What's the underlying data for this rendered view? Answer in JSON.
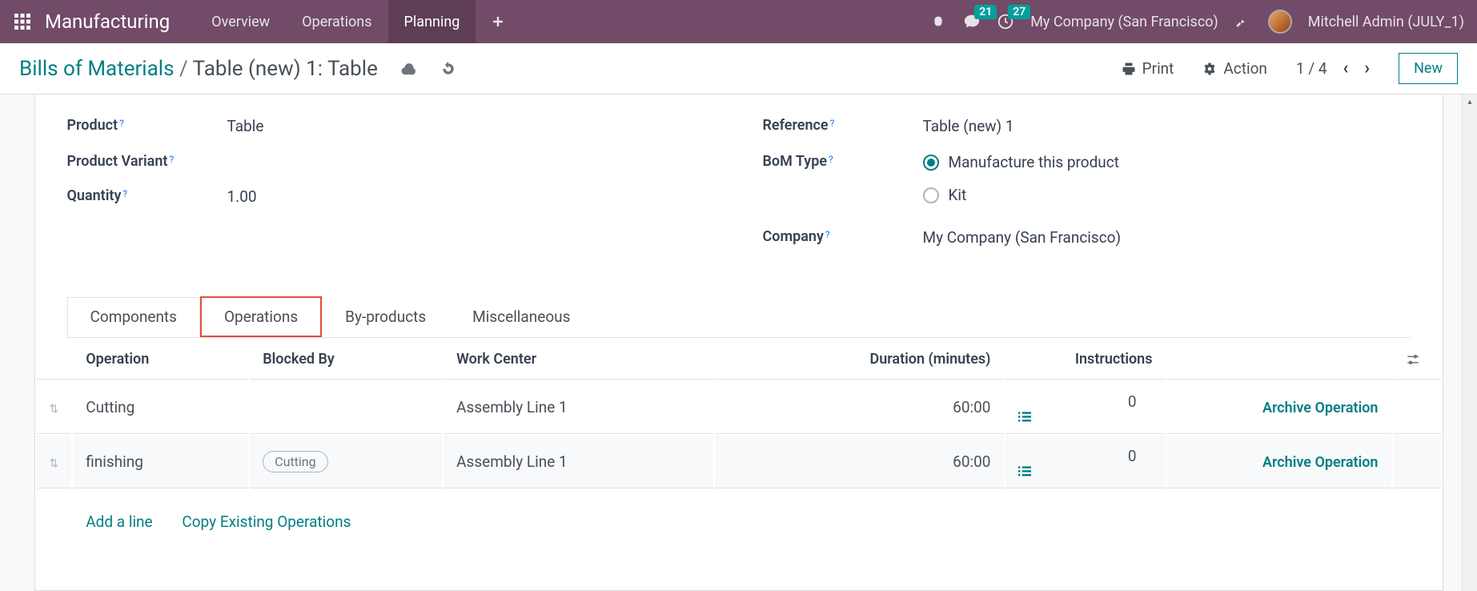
{
  "navbar": {
    "app_name": "Manufacturing",
    "items": [
      {
        "label": "Overview",
        "active": false
      },
      {
        "label": "Operations",
        "active": false
      },
      {
        "label": "Planning",
        "active": true
      }
    ],
    "messages_badge": "21",
    "activities_badge": "27",
    "company": "My Company (San Francisco)",
    "user": "Mitchell Admin (JULY_1)"
  },
  "controlbar": {
    "breadcrumb_root": "Bills of Materials",
    "breadcrumb_current": "Table (new) 1: Table",
    "print_label": "Print",
    "action_label": "Action",
    "pager": "1 / 4",
    "new_label": "New"
  },
  "form": {
    "left": {
      "product_label": "Product",
      "product_value": "Table",
      "variant_label": "Product Variant",
      "quantity_label": "Quantity",
      "quantity_value": "1.00"
    },
    "right": {
      "reference_label": "Reference",
      "reference_value": "Table (new) 1",
      "bom_type_label": "BoM Type",
      "bom_type_options": [
        {
          "label": "Manufacture this product",
          "checked": true
        },
        {
          "label": "Kit",
          "checked": false
        }
      ],
      "company_label": "Company",
      "company_value": "My Company (San Francisco)"
    }
  },
  "tabs": [
    {
      "label": "Components"
    },
    {
      "label": "Operations"
    },
    {
      "label": "By-products"
    },
    {
      "label": "Miscellaneous"
    }
  ],
  "table": {
    "headers": {
      "operation": "Operation",
      "blocked_by": "Blocked By",
      "work_center": "Work Center",
      "duration": "Duration (minutes)",
      "instructions": "Instructions"
    },
    "rows": [
      {
        "operation": "Cutting",
        "blocked_by": "",
        "work_center": "Assembly Line 1",
        "duration": "60:00",
        "instructions": "0",
        "archive": "Archive Operation"
      },
      {
        "operation": "finishing",
        "blocked_by": "Cutting",
        "work_center": "Assembly Line 1",
        "duration": "60:00",
        "instructions": "0",
        "archive": "Archive Operation"
      }
    ],
    "add_line": "Add a line",
    "copy_existing": "Copy Existing Operations"
  }
}
